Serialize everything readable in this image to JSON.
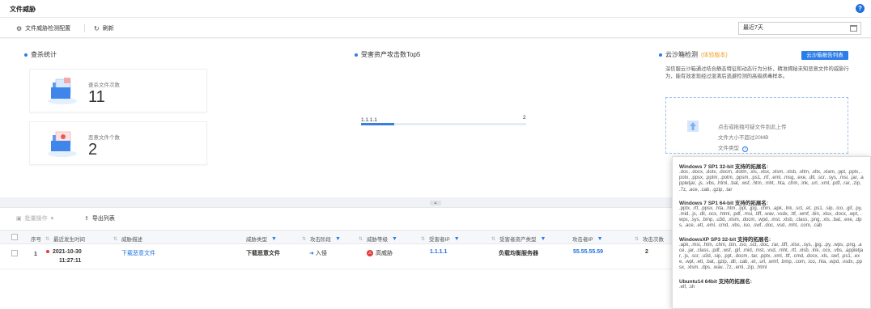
{
  "header": {
    "title": "文件威胁"
  },
  "toolbar": {
    "config_label": "文件威胁检测配置",
    "refresh_label": "刷新",
    "date_range": "最近7天"
  },
  "stats": {
    "title": "查杀统计",
    "scan_label": "查杀文件次数",
    "scan_value": "11",
    "malicious_label": "恶意文件个数",
    "malicious_value": "2"
  },
  "top5": {
    "title": "受害资产攻击数Top5",
    "items": [
      {
        "label": "1.1.1.1",
        "count": "2",
        "fraction": 0.2
      }
    ]
  },
  "sandbox": {
    "title": "云沙箱检测",
    "badge": "(体验版本)",
    "report_button": "云沙箱报告列表",
    "description": "深信服云沙箱通过结合静态特征和动态行为分析，精准揭秘未知恶意文件的威胁行为，能有效发现经过混淆后逃避检测的高级病毒样本。",
    "upload_hint": "点击或拖拽可疑文件到此上传",
    "size_limit": "文件大小不超过20MB",
    "file_type": "文件类型"
  },
  "list": {
    "bulk_label": "批量操作",
    "export_label": "导出列表",
    "columns": {
      "index": "序号",
      "time": "最近发生时间",
      "desc": "威胁描述",
      "type": "威胁类型",
      "stage": "攻击阶段",
      "level": "威胁等级",
      "victim_ip": "受害者IP",
      "asset_type": "受害者资产类型",
      "attacker_ip": "攻击者IP",
      "count": "攻击次数"
    },
    "rows": [
      {
        "index": "1",
        "date": "2021-10-30",
        "time": "11:27:11",
        "desc": "下载恶意文件",
        "type": "下载恶意文件",
        "stage": "入侵",
        "level": "高威胁",
        "victim_ip": "1.1.1.1",
        "asset_type": "负载均衡服务器",
        "attacker_ip": "55.55.55.59",
        "count": "2"
      }
    ]
  },
  "tooltip": {
    "sections": [
      {
        "title": "Windows 7 SP1 32-bit 支持的拓展名:",
        "body": ".doc, .docx, .dotx, .docm, .dotm, .xls, .xlsx, .xlsm, .xlsb, .xltm, .xltx, .xlam, .ppt, .pptx, .potx, .ppsx, .pptm, .potm, .ppsm, .ps1, .rtf, .eml, .msg, .exe, .dll, .scr, .sys, .msi, .jar, .appletjar, .js, .vbs, .html, .bat, .wsf, .htm, .mht, .hta, .chm, .lnk, .url, .xml, .pdf, .rar, .zip, .7z, .ace, .cab, .gzip, .tar"
      },
      {
        "title": "Windows 7 SP1 64-bit 支持的拓展名:",
        "body": ".pptx, .rtf, .ppsx, .hta, .htm, .ppt, .jpg, .chm, .apk, .lnk, .sct, .et, .ps1, .sip, .ico, .gif, .py, .mid, .js, .dll, .ocx, .html, .pdf, .msi, .tiff, .wav, .vsdx, .ttf, .wmf, .bin, .xlsx, .docx, .wpt, .wps, .sys, .bmp, .u3d, .xlsm, .docm, .wpd, .mst, .xlsb, .class, .png, .xls, .bat, .exe, .dps, .ace, .ett, .eml, .cmd, .vbs, .iso, .swf, .doc, .vsd, .mht, .com, .cab"
      },
      {
        "title": "WindowsXP SP3 32-bit 支持的拓展名:",
        "body": ".apk, .msi, .htm, .chm, .bin, .iso, .sct, .doc, .rar, .tiff, .xlsx, .sys, .jpg, .py, .wps, .png, .ace, .jar, .class, .pdf, .wsf, .gif, .mid, .mst, .vsd, .mht, .rtf, .xlsb, .lnk, .ocx, .vbs, .appletjar, .js, .scr, .u3d, .sip, .ppt, .docm, .tar, .pptx, .xml, .ttf, .cmd, .docx, .xls, .swf, .ps1, .exe, .wpt, .ett, .bat, .gzip, .dll, .cab, .et, .url, .wmf, .bmp, .com, .ico, .hta, .wpd, .vsdx, .ppsx, .xlsm, .dps, .wav, .7z, .eml, .zip, .html"
      },
      {
        "title": "Ubuntu14 64bit 支持的拓展名:",
        "body": ".elf, .sh"
      }
    ]
  }
}
